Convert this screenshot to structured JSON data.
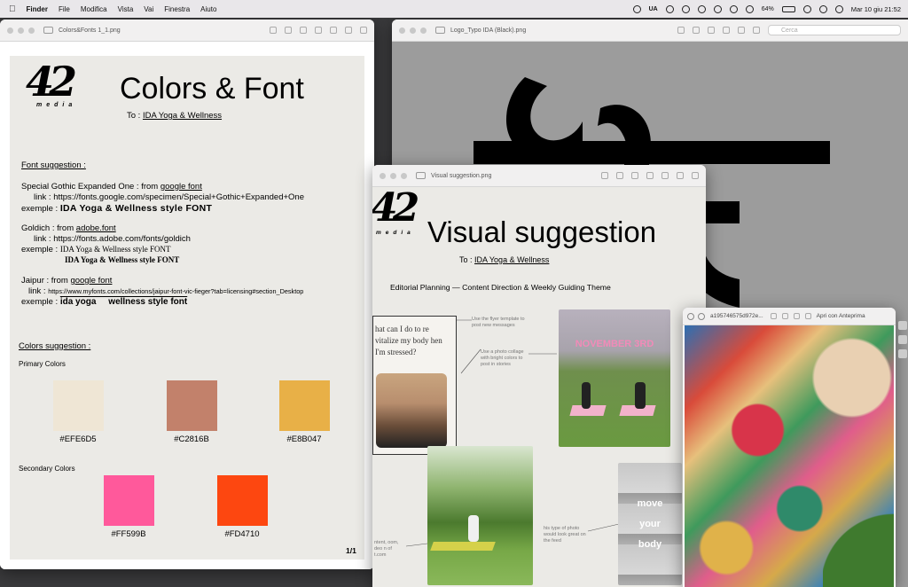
{
  "menubar": {
    "app": "Finder",
    "menus": [
      "File",
      "Modifica",
      "Vista",
      "Vai",
      "Finestra",
      "Aiuto"
    ],
    "status": {
      "keyboard": "UA",
      "battery": "64%",
      "datetime": "Mar 10 giu  21:52"
    }
  },
  "colors_window": {
    "title": "Colors&Fonts 1_1.png",
    "logo_text": "42",
    "logo_sub": "media",
    "heading": "Colors & Font",
    "to_prefix": "To :",
    "to_client": "IDA Yoga & Wellness",
    "font_section_title": "Font suggestion :",
    "fonts": [
      {
        "name": "Special Gothic Expanded One :  from ",
        "source": "google font",
        "link_label": "link :",
        "link": "https://fonts.google.com/specimen/Special+Gothic+Expanded+One",
        "example_label": "exemple :",
        "example": "IDA Yoga & Wellness style FONT"
      },
      {
        "name": "Goldich :  from ",
        "source": "adobe.font",
        "link_label": "link :",
        "link": "https://fonts.adobe.com/fonts/goldich",
        "example_label": "exemple :",
        "example": "IDA Yoga & Wellness style FONT",
        "example2": "IDA Yoga & Wellness style FONT"
      },
      {
        "name": "Jaipur :  from ",
        "source": "google font",
        "link_label": "link :",
        "link": "https://www.myfonts.com/collections/jaipur-font-vic-fieger?tab=licensing#section_Desktop",
        "example_label": "exemple :",
        "example": "ida yoga     wellness style font"
      }
    ],
    "colors_section_title": "Colors suggestion :",
    "primary_label": "Primary Colors",
    "primary": [
      {
        "hex": "#EFE6D5",
        "color": "#EFE6D5"
      },
      {
        "hex": "#C2816B",
        "color": "#C2816B"
      },
      {
        "hex": "#E8B047",
        "color": "#E8B047"
      }
    ],
    "secondary_label": "Secondary Colors",
    "secondary": [
      {
        "hex": "#FF599B",
        "color": "#FF599B"
      },
      {
        "hex": "#FD4710",
        "color": "#FD4710"
      }
    ],
    "page_number": "1/1"
  },
  "logo_window": {
    "title": "Logo_Typo IDA (Black).png",
    "search_placeholder": "Cerca"
  },
  "visual_window": {
    "title": "Visual suggestion.png",
    "heading": "Visual suggestion",
    "to_prefix": "To :",
    "to_client": "IDA Yoga & Wellness",
    "subtitle": "Editorial Planning — Content Direction & Weekly Guiding Theme",
    "quote": "hat can I do to re vitalize my body hen I'm stressed?",
    "note1": "Use the flyer template to post new messages",
    "note2": "Use a photo collage with bright colors to post in stories",
    "note3": "his type of photo would look great on the feed",
    "note4": "ntent, oom, deo n of t.com",
    "event": "NOVEMBER 3RD",
    "collage_words": [
      "move",
      "your",
      "body"
    ]
  },
  "image_window": {
    "title": "a195746575d972e...",
    "open_with": "Apri con Anteprima"
  }
}
